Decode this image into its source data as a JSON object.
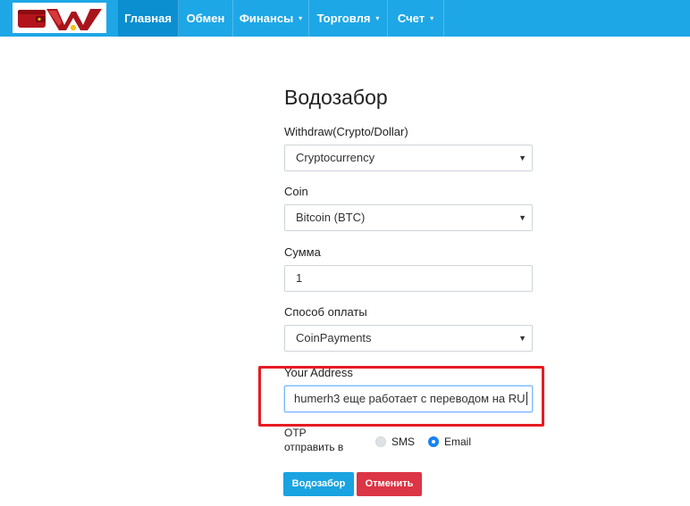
{
  "nav": {
    "items": [
      {
        "label": "Главная",
        "active": true,
        "dropdown": false
      },
      {
        "label": "Обмен",
        "active": false,
        "dropdown": false
      },
      {
        "label": "Финансы",
        "active": false,
        "dropdown": true
      },
      {
        "label": "Торговля",
        "active": false,
        "dropdown": true
      },
      {
        "label": "Счет",
        "active": false,
        "dropdown": true
      }
    ],
    "caret": "▾"
  },
  "form": {
    "title": "Водозабор",
    "withdraw_type": {
      "label": "Withdraw(Crypto/Dollar)",
      "value": "Cryptocurrency"
    },
    "coin": {
      "label": "Coin",
      "value": "Bitcoin (BTC)"
    },
    "amount": {
      "label": "Сумма",
      "value": "1"
    },
    "payment_method": {
      "label": "Способ оплаты",
      "value": "CoinPayments"
    },
    "address": {
      "label": "Your Address",
      "value": "humerh3 еще работает с переводом на RU"
    },
    "otp": {
      "label_line1": "OTP",
      "label_line2": "отправить в",
      "options": [
        {
          "label": "SMS",
          "checked": false
        },
        {
          "label": "Email",
          "checked": true
        }
      ]
    },
    "submit_label": "Водозабор",
    "cancel_label": "Отменить"
  },
  "select_arrow": "▼",
  "colors": {
    "navbar": "#1ea7e6",
    "nav_active": "#0b8fd0",
    "primary_button": "#19a3e0",
    "cancel_button": "#dc3545",
    "highlight_border": "#e81b22",
    "radio_checked": "#1682f2"
  }
}
